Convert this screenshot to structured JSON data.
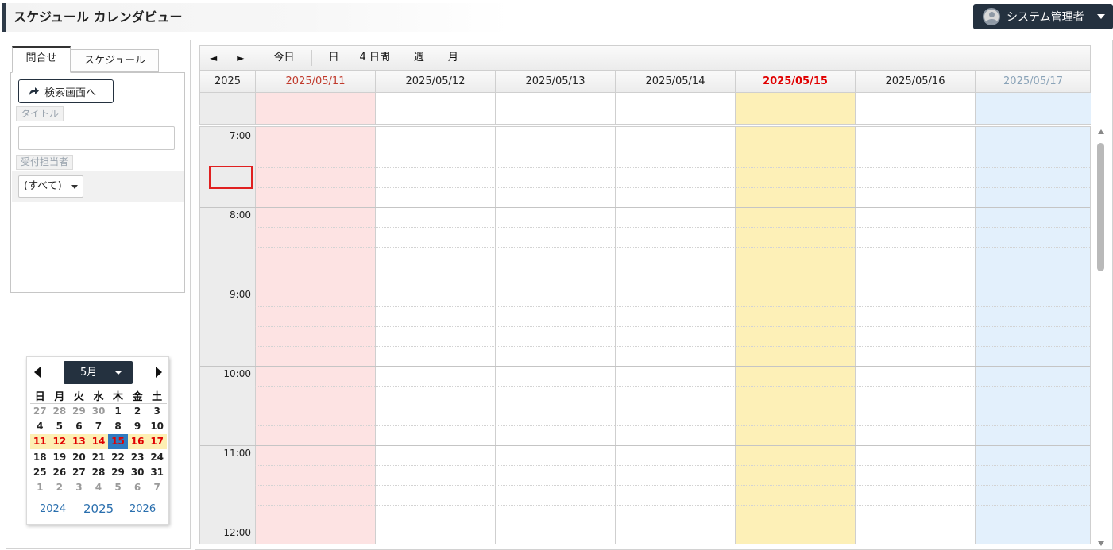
{
  "header": {
    "title": "スケジュール カレンダビュー",
    "user": "システム管理者"
  },
  "left": {
    "tabs": [
      "問合せ",
      "スケジュール"
    ],
    "search_button": "検索画面へ",
    "title_label": "タイトル",
    "title_value": "",
    "assignee_label": "受付担当者",
    "assignee_value": "(すべて)"
  },
  "mini_calendar": {
    "month": "5月",
    "weekdays": [
      "日",
      "月",
      "火",
      "水",
      "木",
      "金",
      "土"
    ],
    "weeks": [
      [
        "27",
        "28",
        "29",
        "30",
        "1",
        "2",
        "3"
      ],
      [
        "4",
        "5",
        "6",
        "7",
        "8",
        "9",
        "10"
      ],
      [
        "11",
        "12",
        "13",
        "14",
        "15",
        "16",
        "17"
      ],
      [
        "18",
        "19",
        "20",
        "21",
        "22",
        "23",
        "24"
      ],
      [
        "25",
        "26",
        "27",
        "28",
        "29",
        "30",
        "31"
      ],
      [
        "1",
        "2",
        "3",
        "4",
        "5",
        "6",
        "7"
      ]
    ],
    "years": [
      "2024",
      "2025",
      "2026"
    ],
    "selected_day": "15"
  },
  "toolbar": {
    "prev": "◄",
    "next": "►",
    "today": "今日",
    "day": "日",
    "four_days": "4 日間",
    "week": "週",
    "month": "月"
  },
  "calendar": {
    "year": "2025",
    "days": [
      "2025/05/11",
      "2025/05/12",
      "2025/05/13",
      "2025/05/14",
      "2025/05/15",
      "2025/05/16",
      "2025/05/17"
    ],
    "hours": [
      "7:00",
      "8:00",
      "9:00",
      "10:00",
      "11:00",
      "12:00"
    ]
  },
  "colors": {
    "accent": "#24313f",
    "sunday_text": "#c0392b",
    "today_text": "#e00000",
    "saturday_text": "#8aa3b8",
    "sunday_bg": "#fde3e3",
    "today_bg": "#fdf0b7",
    "saturday_bg": "#e3f0fc"
  }
}
